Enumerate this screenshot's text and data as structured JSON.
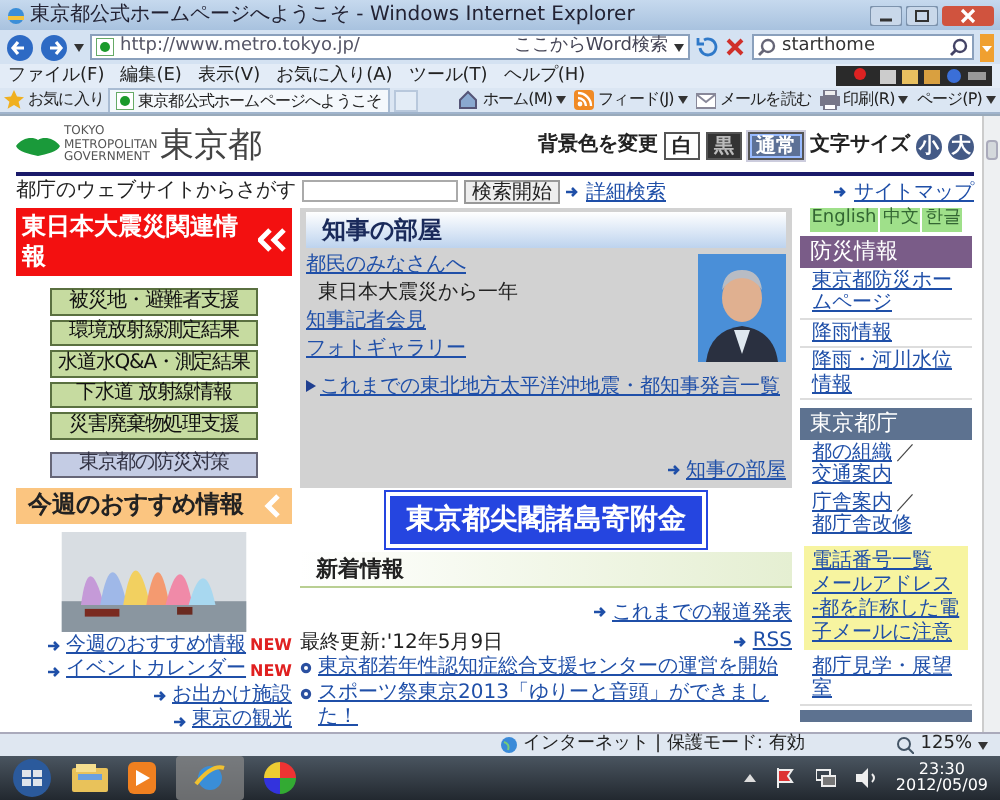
{
  "window": {
    "title": "東京都公式ホームページへようこそ - Windows Internet Explorer"
  },
  "address_bar": {
    "url": "http://www.metro.tokyo.jp/",
    "word_search": "ここからWord検索",
    "search_value": "starthome"
  },
  "menu": [
    "ファイル(F)",
    "編集(E)",
    "表示(V)",
    "お気に入り(A)",
    "ツール(T)",
    "ヘルプ(H)"
  ],
  "favorites_bar": {
    "favorites": "お気に入り",
    "tab": "東京都公式ホームページへようこそ",
    "commands": [
      {
        "kind": "home",
        "label": "ホーム(M)"
      },
      {
        "kind": "feed",
        "label": "フィード(J)"
      },
      {
        "kind": "mail",
        "label": "メールを読む"
      },
      {
        "kind": "print",
        "label": "印刷(R)"
      },
      {
        "kind": "page",
        "label": "ページ(P)"
      }
    ]
  },
  "page": {
    "logo": {
      "small": "TOKYO METROPOLITAN GOVERNMENT",
      "name": "東京都"
    },
    "display_options": {
      "bg_label": "背景色を変更",
      "bg_buttons": [
        {
          "label": "白",
          "kind": "white",
          "selected": false
        },
        {
          "label": "黒",
          "kind": "black",
          "selected": false
        },
        {
          "label": "通常",
          "kind": "normal",
          "selected": true
        }
      ],
      "size_label": "文字サイズ",
      "size_buttons": [
        "小",
        "大"
      ]
    },
    "search": {
      "label": "都庁のウェブサイトからさがす",
      "button": "検索開始",
      "advanced": "詳細検索",
      "sitemap": "サイトマップ"
    },
    "left": {
      "disaster_title": "東日本大震災関連情報",
      "disaster_buttons": [
        {
          "label": "被災地・避難者支援",
          "kind": "green"
        },
        {
          "label": "環境放射線測定結果",
          "kind": "green"
        },
        {
          "label": "水道水Q&A・測定結果",
          "kind": "green"
        },
        {
          "label": "下水道 放射線情報",
          "kind": "green"
        },
        {
          "label": "災害廃棄物処理支援",
          "kind": "green"
        },
        {
          "label": "東京都の防災対策",
          "kind": "blue"
        }
      ],
      "recommend_title": "今週のおすすめ情報",
      "recommend_links": [
        {
          "label": "今週のおすすめ情報",
          "badge": "NEW"
        },
        {
          "label": "イベントカレンダー",
          "badge": "NEW"
        },
        {
          "label": "お出かけ施設"
        },
        {
          "label": "東京の観光"
        }
      ]
    },
    "governor": {
      "title": "知事の部屋",
      "items": [
        {
          "kind": "link",
          "text": "都民のみなさんへ"
        },
        {
          "kind": "text",
          "text": "東日本大震災から一年"
        },
        {
          "kind": "link",
          "text": "知事記者会見"
        },
        {
          "kind": "link",
          "text": "フォトギャラリー"
        }
      ],
      "archive": "これまでの東北地方太平洋沖地震・都知事発言一覧",
      "more": "知事の部屋"
    },
    "banner": "東京都尖閣諸島寄附金",
    "news": {
      "title": "新着情報",
      "archive": "これまでの報道発表",
      "updated": "最終更新:'12年5月9日",
      "rss": "RSS",
      "items": [
        "東京都若年性認知症総合支援センターの運営を開始",
        "スポーツ祭東京2013「ゆりーと音頭」ができました！"
      ]
    },
    "right": {
      "languages": [
        "English",
        "中文",
        "한글"
      ],
      "disaster": {
        "title": "防災情報",
        "links": [
          "東京都防災ホームページ",
          "降雨情報",
          "降雨・河川水位情報"
        ]
      },
      "office": {
        "title": "東京都庁",
        "separator": "／",
        "rows": [
          [
            "都の組織",
            "交通案内"
          ],
          [
            "庁舎案内",
            "都庁舎改修"
          ]
        ]
      },
      "contact": [
        "電話番号一覧",
        "メールアドレス",
        "-都を詐称した電子メールに注意"
      ],
      "tour": "都庁見学・展望室"
    }
  },
  "status_bar": {
    "zone": "インターネット | 保護モード: 有効",
    "zoom": "125%"
  },
  "taskbar": {
    "time": "23:30",
    "date": "2012/05/09"
  }
}
